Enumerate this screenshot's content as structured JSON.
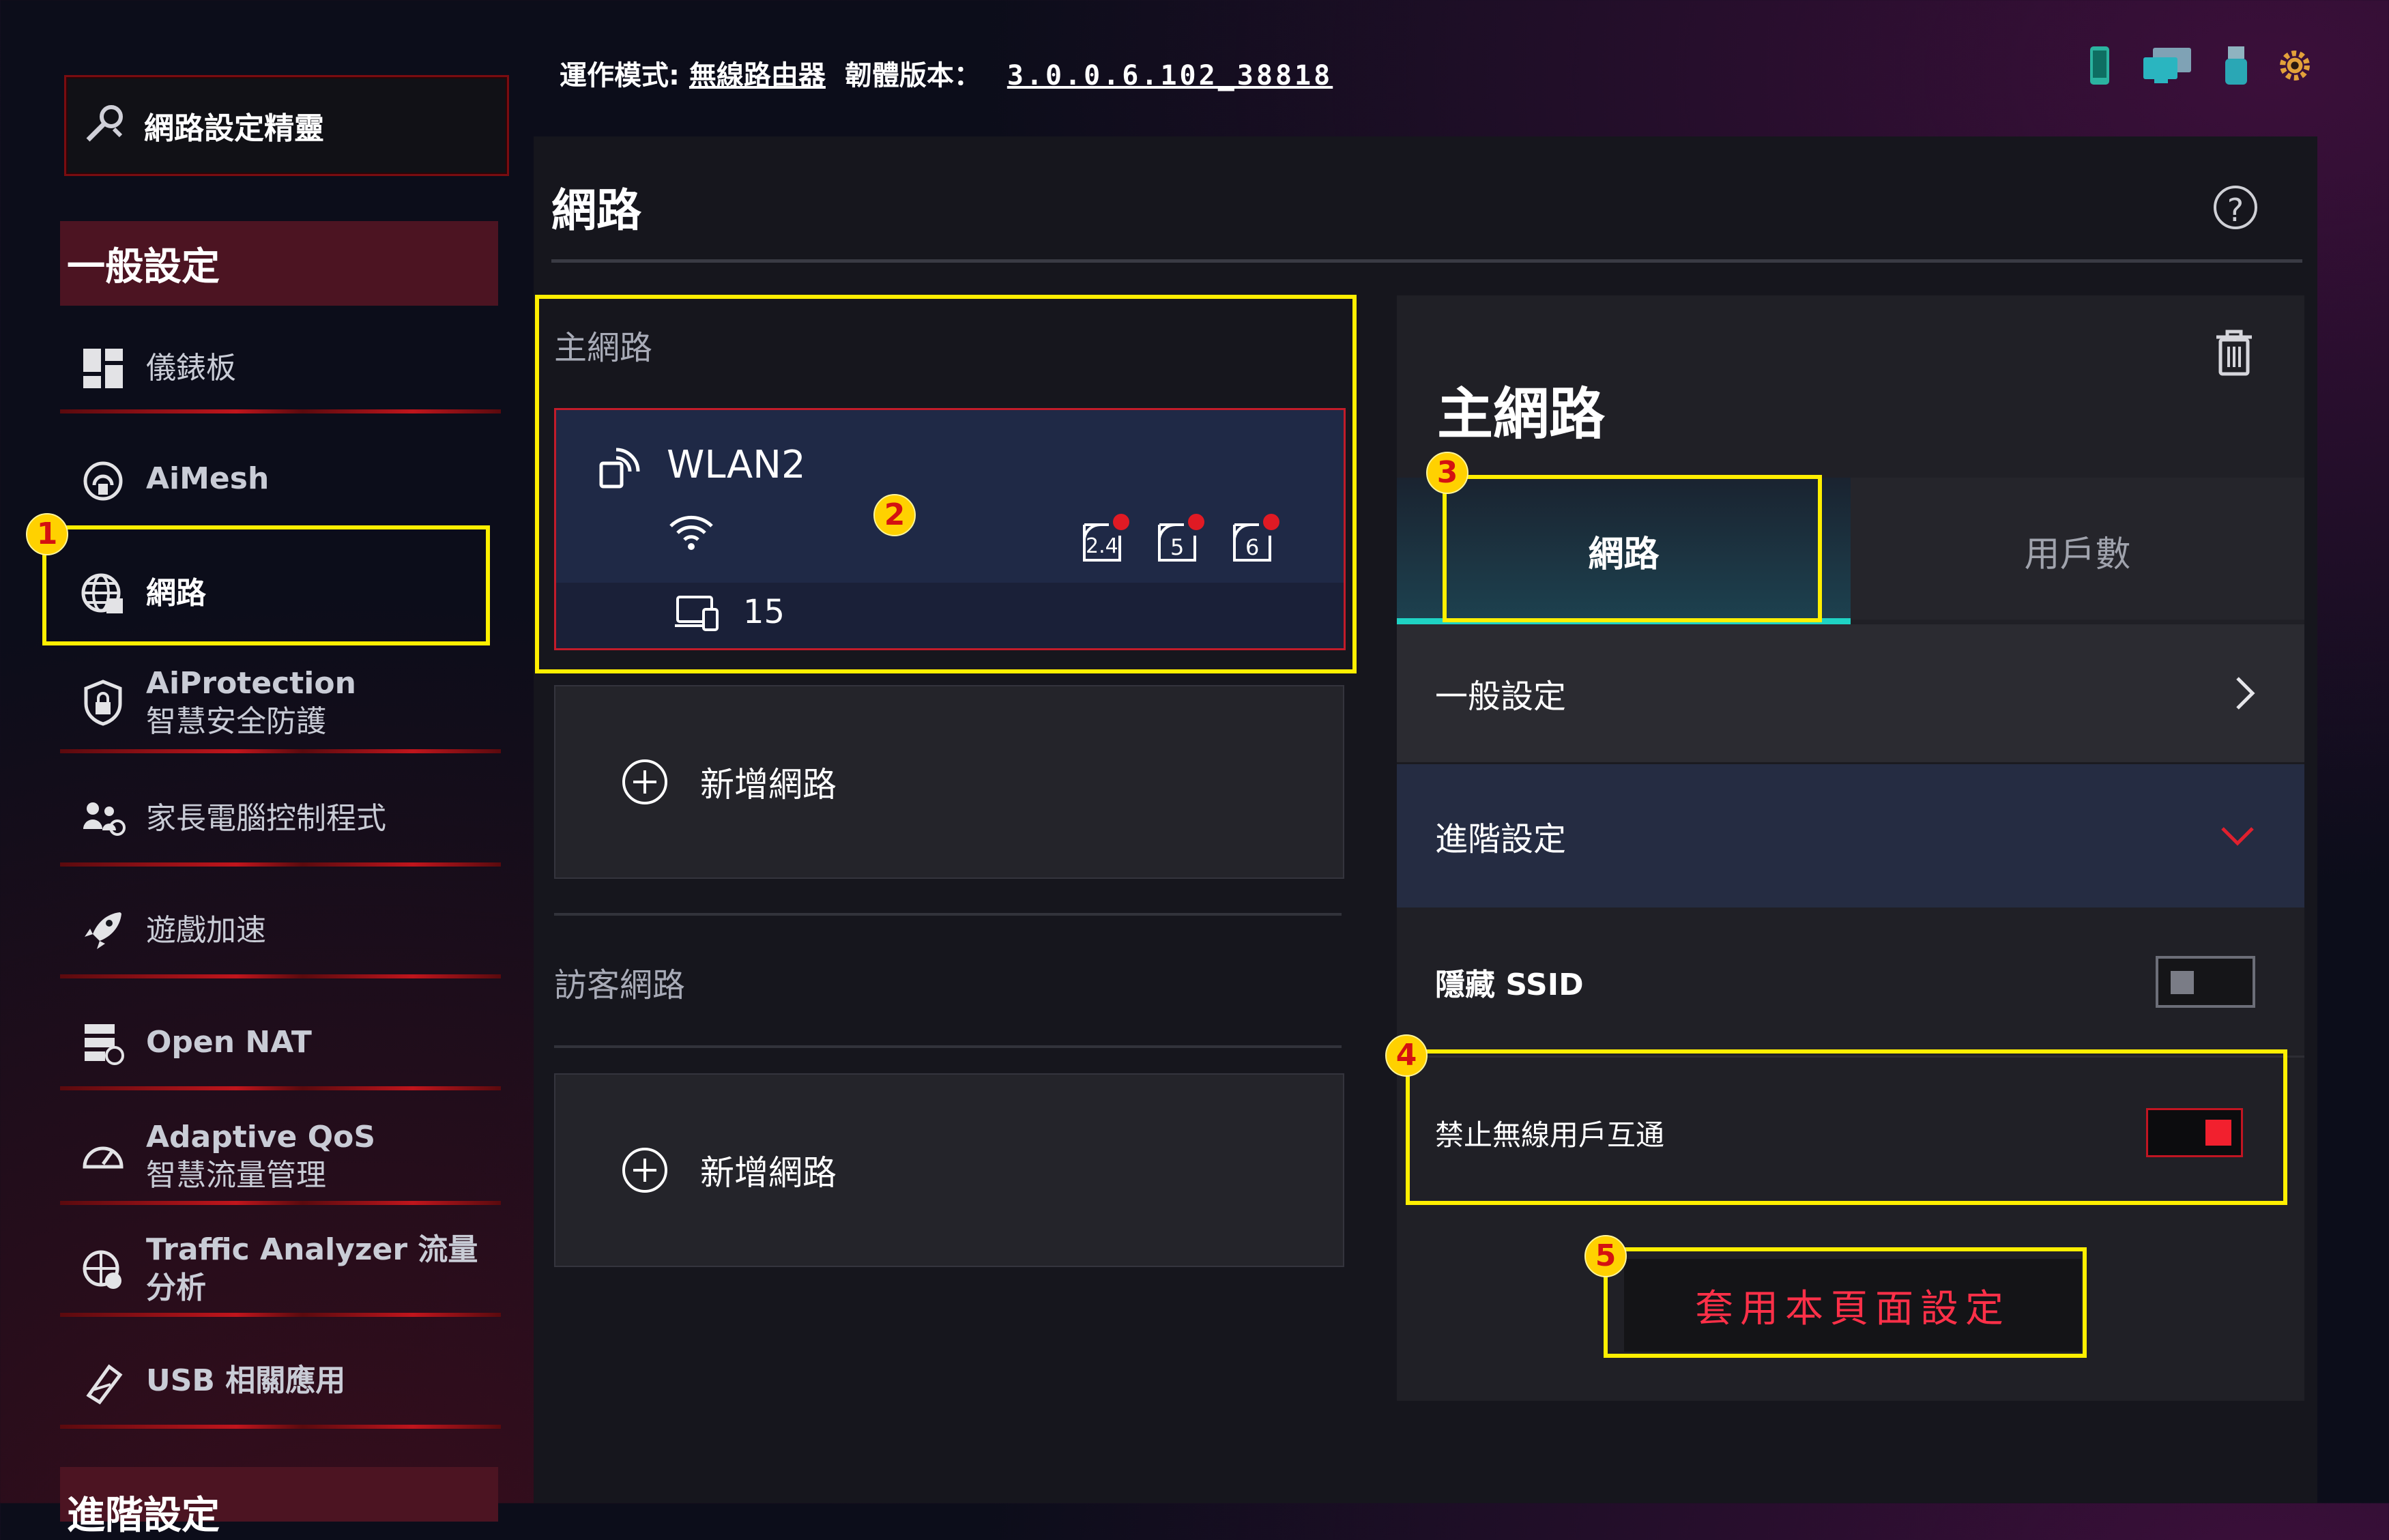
{
  "topbar": {
    "mode_label": "運作模式:",
    "mode_value": "無線路由器",
    "fw_label": "韌體版本：",
    "fw_value": "3.0.0.6.102_38818",
    "icons": [
      "phone-icon",
      "clients-icon",
      "usb-icon",
      "gear-icon"
    ]
  },
  "sidebar": {
    "wizard": "網路設定精靈",
    "section_general": "一般設定",
    "items": [
      {
        "label": "儀錶板",
        "icon": "dashboard-icon"
      },
      {
        "label": "AiMesh",
        "icon": "aimesh-icon"
      },
      {
        "label": "網路",
        "icon": "globe-network-icon"
      },
      {
        "label": "AiProtection",
        "label2": "智慧安全防護",
        "icon": "shield-lock-icon"
      },
      {
        "label": "家長電腦控制程式",
        "icon": "parental-control-icon"
      },
      {
        "label": "遊戲加速",
        "icon": "rocket-icon"
      },
      {
        "label": "Open NAT",
        "icon": "open-nat-icon"
      },
      {
        "label": "Adaptive QoS",
        "label2": "智慧流量管理",
        "icon": "speedometer-icon"
      },
      {
        "label": "Traffic Analyzer 流量分析",
        "icon": "traffic-analyzer-icon"
      },
      {
        "label": "USB 相關應用",
        "icon": "usb-app-icon"
      }
    ],
    "section_advanced": "進階設定"
  },
  "panel": {
    "title": "網路",
    "help": "?",
    "main_network_label": "主網路",
    "wlan": {
      "name": "WLAN2",
      "clients": "15",
      "bands": [
        "2.4",
        "5",
        "6"
      ]
    },
    "add_network": "新增網路",
    "guest_network_label": "訪客網路",
    "add_network_guest": "新增網路"
  },
  "detail": {
    "title": "主網路",
    "tabs": [
      "網路",
      "用戶數"
    ],
    "general": "一般設定",
    "advanced": "進階設定",
    "hide_ssid": "隱藏 SSID",
    "hide_ssid_on": false,
    "isolation": "禁止無線用戶互通",
    "isolation_on": true,
    "apply": "套用本頁面設定"
  },
  "callouts": [
    "1",
    "2",
    "3",
    "4",
    "5"
  ],
  "colors": {
    "accent_red": "#c11522",
    "accent_teal": "#1fd3c4",
    "callout_yellow": "#ffef00"
  }
}
